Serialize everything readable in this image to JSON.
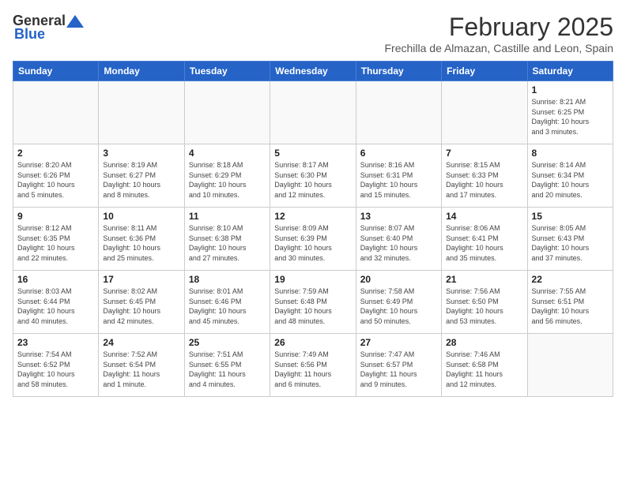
{
  "header": {
    "logo_general": "General",
    "logo_blue": "Blue",
    "month_title": "February 2025",
    "location": "Frechilla de Almazan, Castille and Leon, Spain"
  },
  "days_of_week": [
    "Sunday",
    "Monday",
    "Tuesday",
    "Wednesday",
    "Thursday",
    "Friday",
    "Saturday"
  ],
  "weeks": [
    [
      {
        "day": "",
        "info": ""
      },
      {
        "day": "",
        "info": ""
      },
      {
        "day": "",
        "info": ""
      },
      {
        "day": "",
        "info": ""
      },
      {
        "day": "",
        "info": ""
      },
      {
        "day": "",
        "info": ""
      },
      {
        "day": "1",
        "info": "Sunrise: 8:21 AM\nSunset: 6:25 PM\nDaylight: 10 hours\nand 3 minutes."
      }
    ],
    [
      {
        "day": "2",
        "info": "Sunrise: 8:20 AM\nSunset: 6:26 PM\nDaylight: 10 hours\nand 5 minutes."
      },
      {
        "day": "3",
        "info": "Sunrise: 8:19 AM\nSunset: 6:27 PM\nDaylight: 10 hours\nand 8 minutes."
      },
      {
        "day": "4",
        "info": "Sunrise: 8:18 AM\nSunset: 6:29 PM\nDaylight: 10 hours\nand 10 minutes."
      },
      {
        "day": "5",
        "info": "Sunrise: 8:17 AM\nSunset: 6:30 PM\nDaylight: 10 hours\nand 12 minutes."
      },
      {
        "day": "6",
        "info": "Sunrise: 8:16 AM\nSunset: 6:31 PM\nDaylight: 10 hours\nand 15 minutes."
      },
      {
        "day": "7",
        "info": "Sunrise: 8:15 AM\nSunset: 6:33 PM\nDaylight: 10 hours\nand 17 minutes."
      },
      {
        "day": "8",
        "info": "Sunrise: 8:14 AM\nSunset: 6:34 PM\nDaylight: 10 hours\nand 20 minutes."
      }
    ],
    [
      {
        "day": "9",
        "info": "Sunrise: 8:12 AM\nSunset: 6:35 PM\nDaylight: 10 hours\nand 22 minutes."
      },
      {
        "day": "10",
        "info": "Sunrise: 8:11 AM\nSunset: 6:36 PM\nDaylight: 10 hours\nand 25 minutes."
      },
      {
        "day": "11",
        "info": "Sunrise: 8:10 AM\nSunset: 6:38 PM\nDaylight: 10 hours\nand 27 minutes."
      },
      {
        "day": "12",
        "info": "Sunrise: 8:09 AM\nSunset: 6:39 PM\nDaylight: 10 hours\nand 30 minutes."
      },
      {
        "day": "13",
        "info": "Sunrise: 8:07 AM\nSunset: 6:40 PM\nDaylight: 10 hours\nand 32 minutes."
      },
      {
        "day": "14",
        "info": "Sunrise: 8:06 AM\nSunset: 6:41 PM\nDaylight: 10 hours\nand 35 minutes."
      },
      {
        "day": "15",
        "info": "Sunrise: 8:05 AM\nSunset: 6:43 PM\nDaylight: 10 hours\nand 37 minutes."
      }
    ],
    [
      {
        "day": "16",
        "info": "Sunrise: 8:03 AM\nSunset: 6:44 PM\nDaylight: 10 hours\nand 40 minutes."
      },
      {
        "day": "17",
        "info": "Sunrise: 8:02 AM\nSunset: 6:45 PM\nDaylight: 10 hours\nand 42 minutes."
      },
      {
        "day": "18",
        "info": "Sunrise: 8:01 AM\nSunset: 6:46 PM\nDaylight: 10 hours\nand 45 minutes."
      },
      {
        "day": "19",
        "info": "Sunrise: 7:59 AM\nSunset: 6:48 PM\nDaylight: 10 hours\nand 48 minutes."
      },
      {
        "day": "20",
        "info": "Sunrise: 7:58 AM\nSunset: 6:49 PM\nDaylight: 10 hours\nand 50 minutes."
      },
      {
        "day": "21",
        "info": "Sunrise: 7:56 AM\nSunset: 6:50 PM\nDaylight: 10 hours\nand 53 minutes."
      },
      {
        "day": "22",
        "info": "Sunrise: 7:55 AM\nSunset: 6:51 PM\nDaylight: 10 hours\nand 56 minutes."
      }
    ],
    [
      {
        "day": "23",
        "info": "Sunrise: 7:54 AM\nSunset: 6:52 PM\nDaylight: 10 hours\nand 58 minutes."
      },
      {
        "day": "24",
        "info": "Sunrise: 7:52 AM\nSunset: 6:54 PM\nDaylight: 11 hours\nand 1 minute."
      },
      {
        "day": "25",
        "info": "Sunrise: 7:51 AM\nSunset: 6:55 PM\nDaylight: 11 hours\nand 4 minutes."
      },
      {
        "day": "26",
        "info": "Sunrise: 7:49 AM\nSunset: 6:56 PM\nDaylight: 11 hours\nand 6 minutes."
      },
      {
        "day": "27",
        "info": "Sunrise: 7:47 AM\nSunset: 6:57 PM\nDaylight: 11 hours\nand 9 minutes."
      },
      {
        "day": "28",
        "info": "Sunrise: 7:46 AM\nSunset: 6:58 PM\nDaylight: 11 hours\nand 12 minutes."
      },
      {
        "day": "",
        "info": ""
      }
    ]
  ]
}
